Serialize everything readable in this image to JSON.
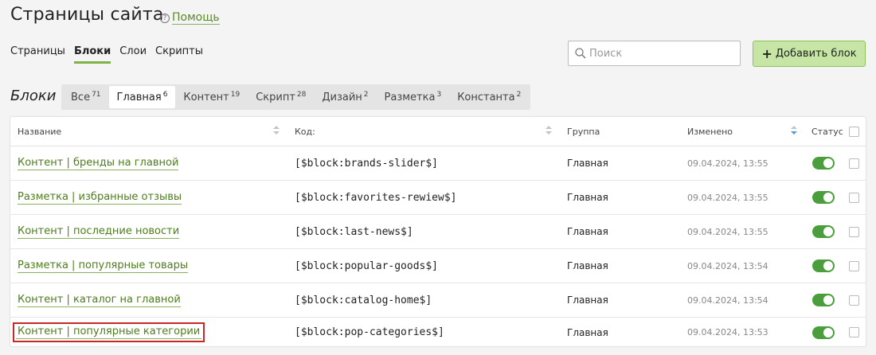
{
  "header": {
    "title": "Страницы сайта",
    "help_icon_glyph": "?",
    "help_label": "Помощь"
  },
  "subnav": [
    {
      "label": "Страницы",
      "active": false
    },
    {
      "label": "Блоки",
      "active": true
    },
    {
      "label": "Слои",
      "active": false
    },
    {
      "label": "Скрипты",
      "active": false
    }
  ],
  "search": {
    "placeholder": "Поиск",
    "value": ""
  },
  "add_button": {
    "label": "Добавить блок"
  },
  "section": {
    "title": "Блоки",
    "filters": [
      {
        "label": "Все",
        "count": "71",
        "active": false
      },
      {
        "label": "Главная",
        "count": "6",
        "active": true
      },
      {
        "label": "Контент",
        "count": "19",
        "active": false
      },
      {
        "label": "Скрипт",
        "count": "28",
        "active": false
      },
      {
        "label": "Дизайн",
        "count": "2",
        "active": false
      },
      {
        "label": "Разметка",
        "count": "3",
        "active": false
      },
      {
        "label": "Константа",
        "count": "2",
        "active": false
      }
    ]
  },
  "table": {
    "columns": {
      "name": "Название",
      "code": "Код:",
      "group": "Группа",
      "modified": "Изменено",
      "status": "Статус"
    },
    "rows": [
      {
        "name": "Контент | бренды на главной",
        "code": "[$block:brands-slider$]",
        "group": "Главная",
        "modified": "09.04.2024, 13:55",
        "status": true
      },
      {
        "name": "Разметка | избранные отзывы",
        "code": "[$block:favorites-rewiew$]",
        "group": "Главная",
        "modified": "09.04.2024, 13:55",
        "status": true
      },
      {
        "name": "Контент | последние новости",
        "code": "[$block:last-news$]",
        "group": "Главная",
        "modified": "09.04.2024, 13:55",
        "status": true
      },
      {
        "name": "Разметка | популярные товары",
        "code": "[$block:popular-goods$]",
        "group": "Главная",
        "modified": "09.04.2024, 13:54",
        "status": true
      },
      {
        "name": "Контент | каталог на главной",
        "code": "[$block:catalog-home$]",
        "group": "Главная",
        "modified": "09.04.2024, 13:54",
        "status": true
      },
      {
        "name": "Контент | популярные категории",
        "code": "[$block:pop-categories$]",
        "group": "Главная",
        "modified": "09.04.2024, 13:53",
        "status": true,
        "highlighted": true
      }
    ]
  },
  "colors": {
    "accent_green": "#7cb342",
    "link_green": "#4e7d1e",
    "toggle_on": "#4a9e3c",
    "highlight_border": "#c62828"
  }
}
